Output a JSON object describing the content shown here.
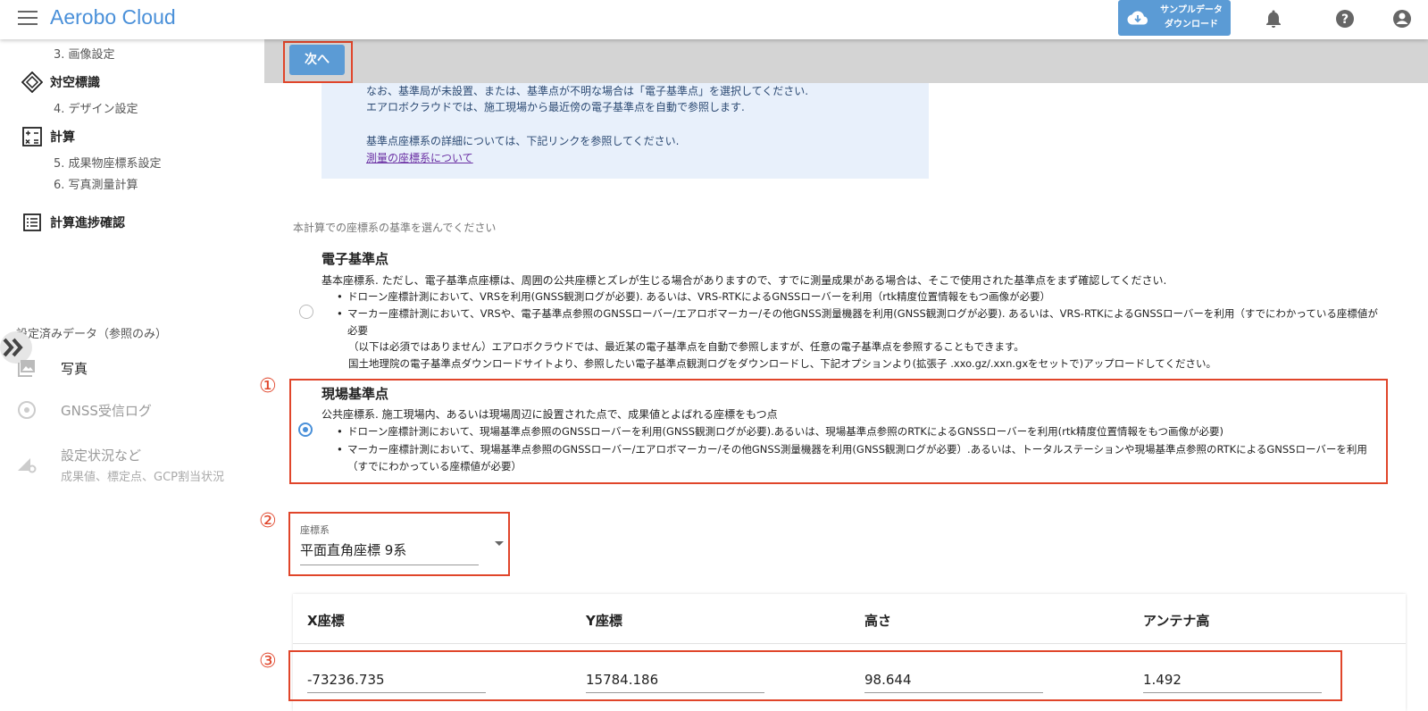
{
  "header": {
    "title": "Aerobo Cloud",
    "sample_line1": "サンプルデータ",
    "sample_line2": "ダウンロード"
  },
  "sidebar": {
    "items": [
      {
        "label": "3. 画像設定"
      },
      {
        "label": "対空標識"
      },
      {
        "label": "4. デザイン設定"
      },
      {
        "label": "計算"
      },
      {
        "label": "5. 成果物座標系設定"
      },
      {
        "label": "6. 写真測量計算"
      },
      {
        "label": "計算進捗確認"
      }
    ],
    "section_title": "設定済みデータ（参照のみ）",
    "ref_items": [
      {
        "label": "写真"
      },
      {
        "label": "GNSS受信ログ"
      },
      {
        "label": "設定状況など",
        "sub": "成果値、標定点、GCP割当状況"
      }
    ]
  },
  "toolbar": {
    "next_label": "次へ"
  },
  "info": {
    "line1": "なお、基準局が未設置、または、基準点が不明な場合は「電子基準点」を選択してください.",
    "line2": "エアロボクラウドでは、施工現場から最近傍の電子基準点を自動で参照します.",
    "line3": "基準点座標系の詳細については、下記リンクを参照してください.",
    "link": "測量の座標系について"
  },
  "prompt": "本計算での座標系の基準を選んでください",
  "options": [
    {
      "title": "電子基準点",
      "selected": false,
      "desc": "基本座標系. ただし、電子基準点座標は、周囲の公共座標とズレが生じる場合がありますので、すでに測量成果がある場合は、そこで使用された基準点をまず確認してください.",
      "bullets": [
        "ドローン座標計測において、VRSを利用(GNSS観測ログが必要). あるいは、VRS-RTKによるGNSSローバーを利用（rtk精度位置情報をもつ画像が必要）",
        "マーカー座標計測において、VRSや、電子基準点参照のGNSSローバー/エアロボマーカー/その他GNSS測量機器を利用(GNSS観測ログが必要). あるいは、VRS-RTKによるGNSSローバーを利用（すでにわかっている座標値が必要"
      ],
      "notes": [
        "（以下は必須ではありません）エアロボクラウドでは、最近某の電子基準点を自動で参照しますが、任意の電子基準点を参照することもできます。",
        "国土地理院の電子基準点ダウンロードサイトより、参照したい電子基準点観測ログをダウンロードし、下記オプションより(拡張子 .xxo.gz/.xxn.gxをセットで)アップロードしてください。"
      ]
    },
    {
      "title": "現場基準点",
      "selected": true,
      "desc": "公共座標系. 施工現場内、あるいは現場周辺に設置された点で、成果値とよばれる座標をもつ点",
      "bullets": [
        "ドローン座標計測において、現場基準点参照のGNSSローバーを利用(GNSS観測ログが必要).あるいは、現場基準点参照のRTKによるGNSSローバーを利用(rtk精度位置情報をもつ画像が必要)",
        "マーカー座標計測において、現場基準点参照のGNSSローバー/エアロボマーカー/その他GNSS測量機器を利用(GNSS観測ログが必要）.あるいは、トータルステーションや現場基準点参照のRTKによるGNSSローバーを利用（すでにわかっている座標値が必要）"
      ]
    }
  ],
  "markers": [
    "①",
    "②",
    "③"
  ],
  "coord_system": {
    "label": "座標系",
    "value": "平面直角座標 9系"
  },
  "table": {
    "headers": [
      "X座標",
      "Y座標",
      "高さ",
      "アンテナ高"
    ],
    "values": [
      "-73236.735",
      "15784.186",
      "98.644",
      "1.492"
    ]
  },
  "colors": {
    "accent": "#5b9bd5",
    "highlight": "#e0452a",
    "info_bg": "#e8f0fb"
  }
}
